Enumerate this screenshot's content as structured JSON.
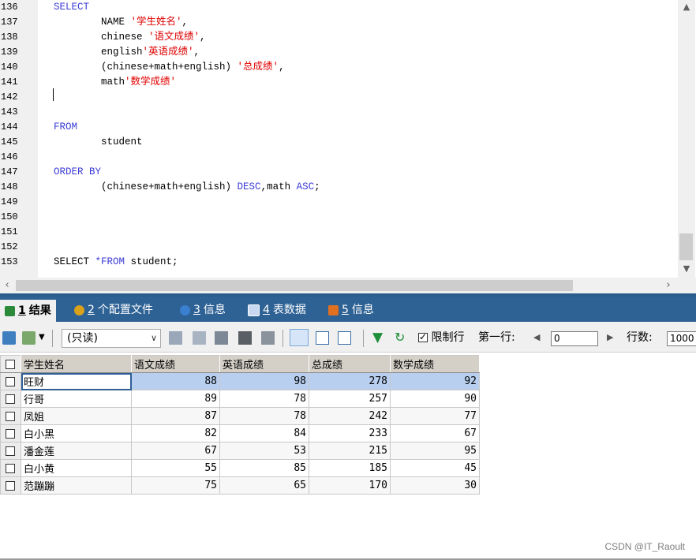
{
  "editor": {
    "line_numbers": [
      "136",
      "137",
      "138",
      "139",
      "140",
      "141",
      "142",
      "143",
      "144",
      "145",
      "146",
      "147",
      "148",
      "149",
      "150",
      "151",
      "152",
      "153"
    ],
    "lines": [
      {
        "parts": [
          {
            "t": "SELECT",
            "c": "kw"
          }
        ]
      },
      {
        "parts": [
          {
            "t": "        NAME ",
            "c": ""
          },
          {
            "t": "'学生姓名'",
            "c": "str"
          },
          {
            "t": ",",
            "c": ""
          }
        ]
      },
      {
        "parts": [
          {
            "t": "        chinese ",
            "c": ""
          },
          {
            "t": "'语文成绩'",
            "c": "str"
          },
          {
            "t": ",",
            "c": ""
          }
        ]
      },
      {
        "parts": [
          {
            "t": "        english",
            "c": ""
          },
          {
            "t": "'英语成绩'",
            "c": "str"
          },
          {
            "t": ",",
            "c": ""
          }
        ]
      },
      {
        "parts": [
          {
            "t": "        (chinese+math+english) ",
            "c": ""
          },
          {
            "t": "'总成绩'",
            "c": "str"
          },
          {
            "t": ",",
            "c": ""
          }
        ]
      },
      {
        "parts": [
          {
            "t": "        math",
            "c": ""
          },
          {
            "t": "'数学成绩'",
            "c": "str"
          }
        ]
      },
      {
        "parts": []
      },
      {
        "parts": []
      },
      {
        "parts": [
          {
            "t": "FROM",
            "c": "kw"
          }
        ]
      },
      {
        "parts": [
          {
            "t": "        student",
            "c": ""
          }
        ]
      },
      {
        "parts": []
      },
      {
        "parts": [
          {
            "t": "ORDER BY",
            "c": "kw"
          }
        ]
      },
      {
        "parts": [
          {
            "t": "        (chinese+math+english) ",
            "c": ""
          },
          {
            "t": "DESC",
            "c": "kw"
          },
          {
            "t": ",math ",
            "c": ""
          },
          {
            "t": "ASC",
            "c": "kw"
          },
          {
            "t": ";",
            "c": ""
          }
        ]
      },
      {
        "parts": []
      },
      {
        "parts": []
      },
      {
        "parts": []
      },
      {
        "parts": []
      },
      {
        "parts": [
          {
            "t": "SELECT ",
            "c": ""
          },
          {
            "t": "*FROM",
            "c": "kw"
          },
          {
            "t": " student;",
            "c": ""
          }
        ]
      }
    ]
  },
  "tabs": [
    {
      "num": "1",
      "label": "结果",
      "active": true,
      "icon_color": "#2a8a3a"
    },
    {
      "num": "2",
      "label": "个配置文件",
      "active": false,
      "icon_color": "#d9a11c"
    },
    {
      "num": "3",
      "label": "信息",
      "active": false,
      "icon_color": "#3a7fd0"
    },
    {
      "num": "4",
      "label": "表数据",
      "active": false,
      "icon_color": "#c8d8f0"
    },
    {
      "num": "5",
      "label": "信息",
      "active": false,
      "icon_color": "#e07020"
    }
  ],
  "toolbar": {
    "readonly_label": "(只读)",
    "limit_label": "限制行",
    "first_row_label": "第一行:",
    "first_row_value": "0",
    "rows_label": "行数:",
    "rows_value": "1000"
  },
  "grid": {
    "columns": [
      "学生姓名",
      "语文成绩",
      "英语成绩",
      "总成绩",
      "数学成绩"
    ],
    "rows": [
      [
        "旺财",
        "88",
        "98",
        "278",
        "92"
      ],
      [
        "行哥",
        "89",
        "78",
        "257",
        "90"
      ],
      [
        "凤姐",
        "87",
        "78",
        "242",
        "77"
      ],
      [
        "白小黑",
        "82",
        "84",
        "233",
        "67"
      ],
      [
        "潘金莲",
        "67",
        "53",
        "215",
        "95"
      ],
      [
        "白小黄",
        "55",
        "85",
        "185",
        "45"
      ],
      [
        "范蹦蹦",
        "75",
        "65",
        "170",
        "30"
      ]
    ]
  },
  "watermark": "CSDN @IT_Raoult",
  "colors": {
    "keyword": "#3b3bd6",
    "string": "#e00000",
    "tabbar": "#2e6295",
    "selection": "#b8cfef"
  }
}
